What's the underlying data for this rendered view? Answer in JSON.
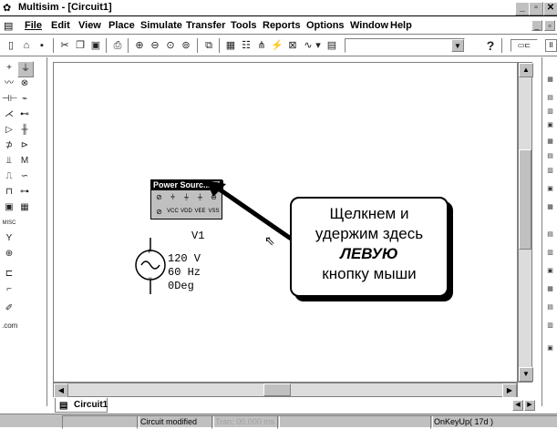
{
  "app": {
    "title": "Multisim - [Circuit1]"
  },
  "menu": {
    "items": [
      "File",
      "Edit",
      "View",
      "Place",
      "Simulate",
      "Transfer",
      "Tools",
      "Reports",
      "Options",
      "Window",
      "Help"
    ]
  },
  "toolbar": {
    "help_label": "?"
  },
  "power_palette": {
    "title": "Power Sourc..."
  },
  "component": {
    "refdes": "V1",
    "voltage": "120 V",
    "frequency": "60 Hz",
    "phase": "0Deg"
  },
  "callout": {
    "line1": "Щелкнем и",
    "line2": "удержим здесь",
    "line3": "ЛЕВУЮ",
    "line4": "кнопку мыши"
  },
  "tabs": [
    "Circuit1"
  ],
  "status": {
    "message": "Circuit modified",
    "tran": "Tran: 00.000 ms",
    "event": "OnKeyUp( 17d )"
  }
}
